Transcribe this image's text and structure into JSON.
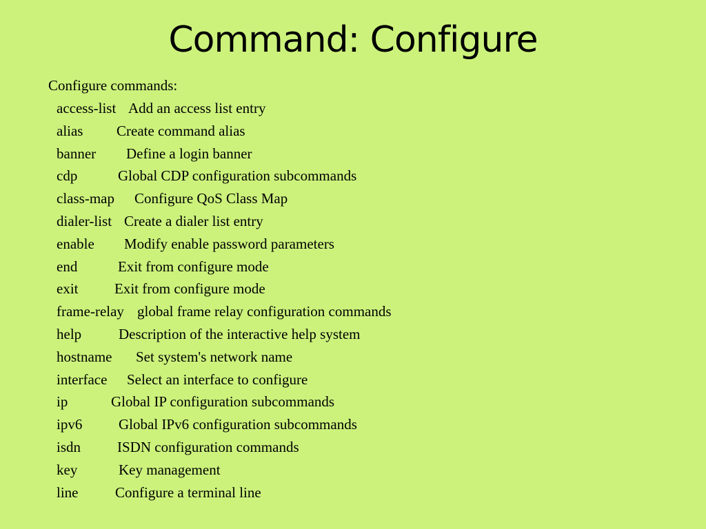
{
  "title": "Command:  Configure",
  "heading": "Configure commands:",
  "commands": [
    {
      "cmd": "access-list",
      "desc": "Add an access list entry"
    },
    {
      "cmd": "alias",
      "desc": "Create command alias"
    },
    {
      "cmd": "banner",
      "desc": "Define a login banner"
    },
    {
      "cmd": "cdp",
      "desc": "Global CDP configuration subcommands"
    },
    {
      "cmd": "class-map",
      "desc": "Configure QoS Class Map"
    },
    {
      "cmd": "dialer-list",
      "desc": "Create a dialer list entry"
    },
    {
      "cmd": "enable",
      "desc": "Modify enable password parameters"
    },
    {
      "cmd": "end",
      "desc": "Exit from configure mode"
    },
    {
      "cmd": "exit",
      "desc": "Exit from configure mode"
    },
    {
      "cmd": "frame-relay",
      "desc": "global frame relay configuration commands"
    },
    {
      "cmd": "help",
      "desc": "Description of the interactive help system"
    },
    {
      "cmd": "hostname",
      "desc": "Set system's network name"
    },
    {
      "cmd": "interface",
      "desc": "Select an interface to configure"
    },
    {
      "cmd": "ip",
      "desc": "Global IP configuration subcommands"
    },
    {
      "cmd": "ipv6",
      "desc": "Global IPv6 configuration subcommands"
    },
    {
      "cmd": "isdn",
      "desc": "ISDN configuration commands"
    },
    {
      "cmd": "key",
      "desc": "Key management"
    },
    {
      "cmd": "line",
      "desc": "Configure a terminal line"
    }
  ]
}
